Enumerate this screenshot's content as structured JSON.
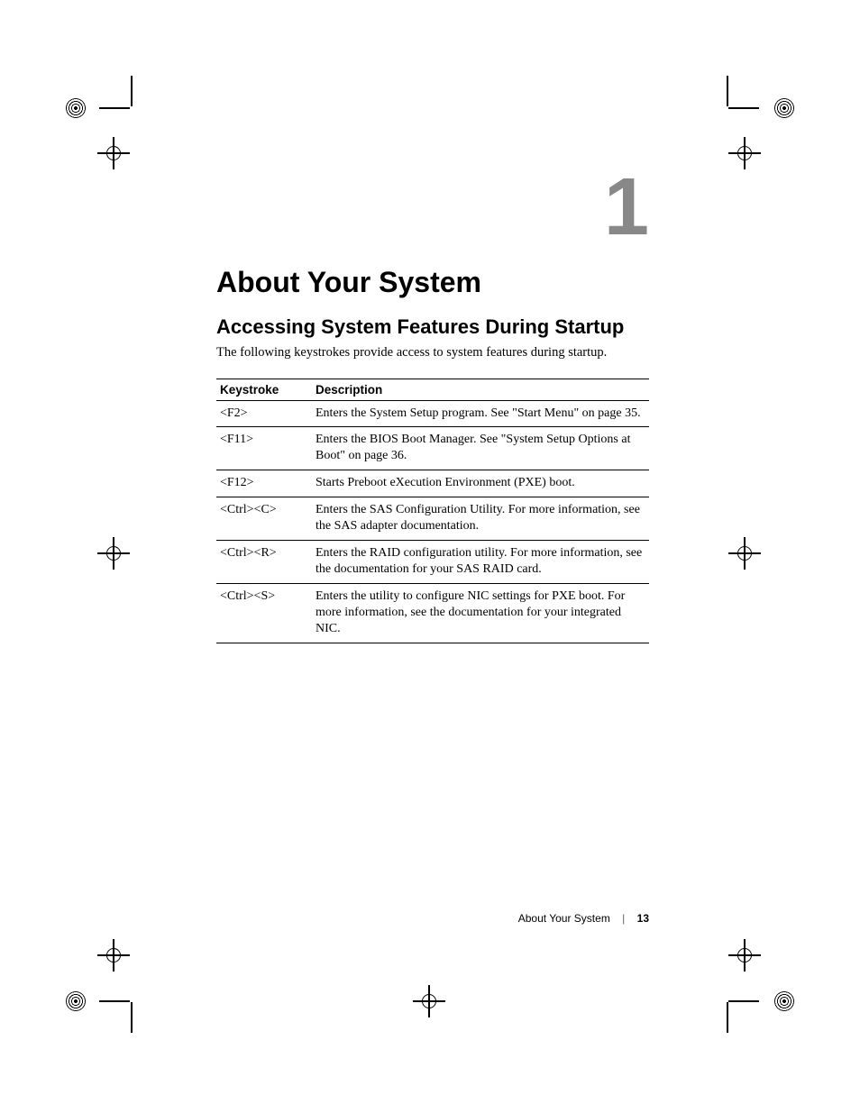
{
  "chapter": {
    "number": "1",
    "title": "About Your System"
  },
  "section": {
    "title": "Accessing System Features During Startup"
  },
  "intro": "The following keystrokes provide access to system features during startup.",
  "table": {
    "headers": {
      "keystroke": "Keystroke",
      "description": "Description"
    },
    "rows": [
      {
        "key": "<F2>",
        "desc": "Enters the System Setup program. See \"Start Menu\" on page 35."
      },
      {
        "key": "<F11>",
        "desc": "Enters the BIOS Boot Manager. See \"System Setup Options at Boot\" on page 36."
      },
      {
        "key": "<F12>",
        "desc": "Starts Preboot eXecution Environment (PXE) boot."
      },
      {
        "key": "<Ctrl><C>",
        "desc": "Enters the SAS Configuration Utility. For more information, see the SAS adapter documentation."
      },
      {
        "key": "<Ctrl><R>",
        "desc": "Enters the RAID configuration utility. For more information, see the documentation for your SAS RAID card."
      },
      {
        "key": "<Ctrl><S>",
        "desc": "Enters the utility to configure NIC settings for PXE boot. For more information, see the documentation for your integrated NIC."
      }
    ]
  },
  "footer": {
    "section": "About Your System",
    "page": "13"
  }
}
